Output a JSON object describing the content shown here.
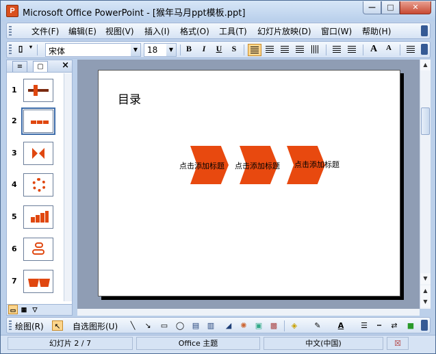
{
  "window": {
    "title": "Microsoft Office PowerPoint - [猴年马月ppt模板.ppt]",
    "min_glyph": "—",
    "max_glyph": "□",
    "close_glyph": "✕"
  },
  "menu": [
    "文件(F)",
    "编辑(E)",
    "视图(V)",
    "插入(I)",
    "格式(O)",
    "工具(T)",
    "幻灯片放映(D)",
    "窗口(W)",
    "帮助(H)"
  ],
  "format_toolbar": {
    "font_name": "宋体",
    "font_size": "18",
    "bold": "B",
    "italic": "I",
    "underline": "U",
    "shadow": "S",
    "increase_font": "A",
    "decrease_font": "A"
  },
  "left_pane": {
    "close_glyph": "×",
    "slides": [
      {
        "number": "1"
      },
      {
        "number": "2",
        "selected": true
      },
      {
        "number": "3"
      },
      {
        "number": "4"
      },
      {
        "number": "5"
      },
      {
        "number": "6"
      },
      {
        "number": "7"
      }
    ]
  },
  "slide": {
    "title": "目录",
    "items": [
      "点击添加标题",
      "点击添加标题",
      "点击添加标题"
    ],
    "accent_color": "#e8490f"
  },
  "drawing_toolbar": {
    "draw_label": "绘图(R)",
    "autoshapes_label": "自选图形(U)"
  },
  "status": {
    "slide_position": "幻灯片 2 / 7",
    "theme": "Office 主题",
    "language": "中文(中国)"
  }
}
